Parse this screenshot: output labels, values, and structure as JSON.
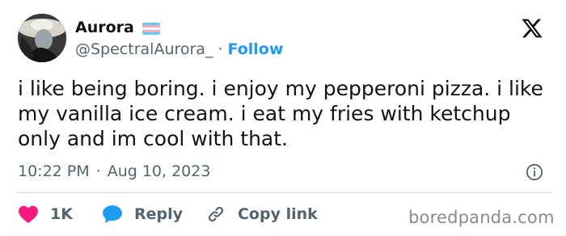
{
  "tweet": {
    "author": {
      "display_name": "Aurora",
      "handle": "@SpectralAurora_",
      "separator": "·",
      "follow_label": "Follow",
      "flag_colors": [
        "#5bcefa",
        "#f5a9b8",
        "#ffffff",
        "#f5a9b8",
        "#5bcefa"
      ]
    },
    "text": "i like being boring. i enjoy my pepperoni pizza. i like my vanilla ice cream. i eat my fries with ketchup only and im cool with that.",
    "time": "10:22 PM",
    "date_separator": "·",
    "date": "Aug 10, 2023",
    "actions": {
      "like_count": "1K",
      "reply_label": "Reply",
      "copy_link_label": "Copy link"
    }
  },
  "icons": {
    "platform_logo": "x-logo-icon",
    "info": "info-icon",
    "like": "heart-icon",
    "reply": "speech-bubble-icon",
    "copy_link": "link-icon"
  },
  "colors": {
    "text": "#0f1419",
    "secondary": "#536471",
    "accent": "#1d9bf0",
    "like": "#f91880",
    "divider": "#cfd9de"
  },
  "watermark": "boredpanda.com"
}
